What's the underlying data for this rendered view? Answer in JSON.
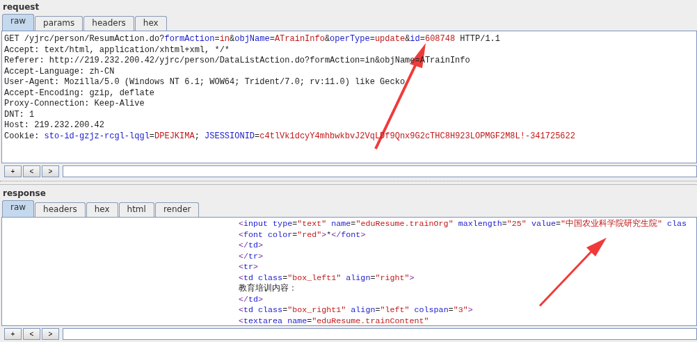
{
  "request": {
    "title": "request",
    "tabs": [
      {
        "label": "raw",
        "selected": true
      },
      {
        "label": "params",
        "selected": false
      },
      {
        "label": "headers",
        "selected": false
      },
      {
        "label": "hex",
        "selected": false
      }
    ],
    "lines": [
      [
        {
          "kind": "text",
          "text": "GET /yjrc/person/ResumAction.do?"
        },
        {
          "kind": "name",
          "text": "formAction"
        },
        {
          "kind": "text",
          "text": "="
        },
        {
          "kind": "value",
          "text": "in"
        },
        {
          "kind": "text",
          "text": "&"
        },
        {
          "kind": "name",
          "text": "objName"
        },
        {
          "kind": "text",
          "text": "="
        },
        {
          "kind": "value",
          "text": "ATrainInfo"
        },
        {
          "kind": "text",
          "text": "&"
        },
        {
          "kind": "name",
          "text": "operType"
        },
        {
          "kind": "text",
          "text": "="
        },
        {
          "kind": "value",
          "text": "update"
        },
        {
          "kind": "text",
          "text": "&"
        },
        {
          "kind": "name",
          "text": "id"
        },
        {
          "kind": "text",
          "text": "="
        },
        {
          "kind": "value",
          "text": "608748"
        },
        {
          "kind": "text",
          "text": " HTTP/1.1"
        }
      ],
      [
        {
          "kind": "text",
          "text": "Accept: text/html, application/xhtml+xml, */*"
        }
      ],
      [
        {
          "kind": "text",
          "text": "Referer: http://219.232.200.42/yjrc/person/DataListAction.do?formAction=in&objName=ATrainInfo"
        }
      ],
      [
        {
          "kind": "text",
          "text": "Accept-Language: zh-CN"
        }
      ],
      [
        {
          "kind": "text",
          "text": "User-Agent: Mozilla/5.0 (Windows NT 6.1; WOW64; Trident/7.0; rv:11.0) like Gecko"
        }
      ],
      [
        {
          "kind": "text",
          "text": "Accept-Encoding: gzip, deflate"
        }
      ],
      [
        {
          "kind": "text",
          "text": "Proxy-Connection: Keep-Alive"
        }
      ],
      [
        {
          "kind": "text",
          "text": "DNT: 1"
        }
      ],
      [
        {
          "kind": "text",
          "text": "Host: 219.232.200.42"
        }
      ],
      [
        {
          "kind": "text",
          "text": "Cookie: "
        },
        {
          "kind": "name",
          "text": "sto-id-gzjz-rcgl-lqgl"
        },
        {
          "kind": "text",
          "text": "="
        },
        {
          "kind": "value",
          "text": "DPEJKIMA"
        },
        {
          "kind": "text",
          "text": "; "
        },
        {
          "kind": "name",
          "text": "JSESSIONID"
        },
        {
          "kind": "text",
          "text": "="
        },
        {
          "kind": "value",
          "text": "c4tlVk1dcyY4mhbwkbvJ2VqLDf9Qnx9G2cTHC8H923LOPMGF2M8L!-341725622"
        }
      ]
    ],
    "buttons": [
      "+",
      "<",
      ">"
    ]
  },
  "response": {
    "title": "response",
    "tabs": [
      {
        "label": "raw",
        "selected": true
      },
      {
        "label": "headers",
        "selected": false
      },
      {
        "label": "hex",
        "selected": false
      },
      {
        "label": "html",
        "selected": false
      },
      {
        "label": "render",
        "selected": false
      }
    ],
    "lines": [
      [
        {
          "kind": "punct",
          "text": "<"
        },
        {
          "kind": "name",
          "text": "input"
        },
        {
          "kind": "name",
          "text": " type"
        },
        {
          "kind": "text",
          "text": "="
        },
        {
          "kind": "value",
          "text": "\"text\""
        },
        {
          "kind": "name",
          "text": " name"
        },
        {
          "kind": "text",
          "text": "="
        },
        {
          "kind": "value",
          "text": "\"eduResume.trainOrg\""
        },
        {
          "kind": "name",
          "text": " maxlength"
        },
        {
          "kind": "text",
          "text": "="
        },
        {
          "kind": "value",
          "text": "\"25\""
        },
        {
          "kind": "name",
          "text": " value"
        },
        {
          "kind": "text",
          "text": "="
        },
        {
          "kind": "value",
          "text": "\"中国农业科学院研究生院\""
        },
        {
          "kind": "name",
          "text": " clas"
        }
      ],
      [
        {
          "kind": "punct",
          "text": "<"
        },
        {
          "kind": "name",
          "text": "font"
        },
        {
          "kind": "name",
          "text": " color"
        },
        {
          "kind": "text",
          "text": "="
        },
        {
          "kind": "value",
          "text": "\"red\""
        },
        {
          "kind": "punct",
          "text": ">"
        },
        {
          "kind": "text",
          "text": "*"
        },
        {
          "kind": "punct",
          "text": "</"
        },
        {
          "kind": "name",
          "text": "font"
        },
        {
          "kind": "punct",
          "text": ">"
        }
      ],
      [
        {
          "kind": "punct",
          "text": "</"
        },
        {
          "kind": "name",
          "text": "td"
        },
        {
          "kind": "punct",
          "text": ">"
        }
      ],
      [
        {
          "kind": "punct",
          "text": "</"
        },
        {
          "kind": "name",
          "text": "tr"
        },
        {
          "kind": "punct",
          "text": ">"
        }
      ],
      [
        {
          "kind": "punct",
          "text": "<"
        },
        {
          "kind": "name",
          "text": "tr"
        },
        {
          "kind": "punct",
          "text": ">"
        }
      ],
      [
        {
          "kind": "punct",
          "text": "<"
        },
        {
          "kind": "name",
          "text": "td"
        },
        {
          "kind": "name",
          "text": " class"
        },
        {
          "kind": "text",
          "text": "="
        },
        {
          "kind": "value",
          "text": "\"box_left1\""
        },
        {
          "kind": "name",
          "text": " align"
        },
        {
          "kind": "text",
          "text": "="
        },
        {
          "kind": "value",
          "text": "\"right\""
        },
        {
          "kind": "punct",
          "text": ">"
        }
      ],
      [
        {
          "kind": "text",
          "text": "教育培训内容："
        }
      ],
      [
        {
          "kind": "punct",
          "text": "</"
        },
        {
          "kind": "name",
          "text": "td"
        },
        {
          "kind": "punct",
          "text": ">"
        }
      ],
      [
        {
          "kind": "punct",
          "text": "<"
        },
        {
          "kind": "name",
          "text": "td"
        },
        {
          "kind": "name",
          "text": " class"
        },
        {
          "kind": "text",
          "text": "="
        },
        {
          "kind": "value",
          "text": "\"box_right1\""
        },
        {
          "kind": "name",
          "text": " align"
        },
        {
          "kind": "text",
          "text": "="
        },
        {
          "kind": "value",
          "text": "\"left\""
        },
        {
          "kind": "name",
          "text": " colspan"
        },
        {
          "kind": "text",
          "text": "="
        },
        {
          "kind": "value",
          "text": "\"3\""
        },
        {
          "kind": "punct",
          "text": ">"
        }
      ],
      [
        {
          "kind": "punct",
          "text": "<"
        },
        {
          "kind": "name",
          "text": "textarea"
        },
        {
          "kind": "name",
          "text": " name"
        },
        {
          "kind": "text",
          "text": "="
        },
        {
          "kind": "value",
          "text": "\"eduResume.trainContent\""
        }
      ]
    ],
    "buttons": [
      "+",
      "<",
      ">"
    ]
  }
}
